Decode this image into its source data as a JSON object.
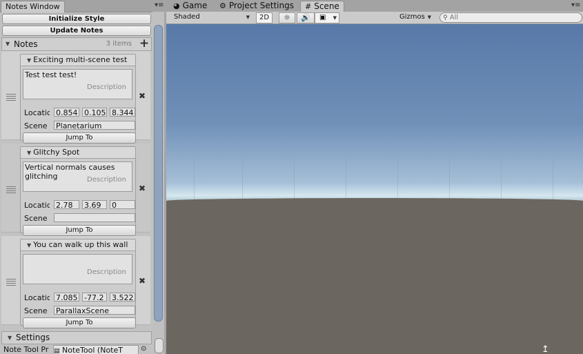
{
  "left_panel": {
    "tab_title": "Notes Window",
    "initialize_style_label": "Initialize Style",
    "update_notes_label": "Update Notes",
    "notes_header": {
      "title": "Notes",
      "count": "3 items"
    },
    "notes": [
      {
        "title": "Exciting multi-scene test",
        "description": "Test test test!",
        "description_placeholder": "Description",
        "location_label": "Locatic",
        "location": [
          "0.854",
          "0.105",
          "8.344"
        ],
        "scene_label": "Scene",
        "scene": "Planetarium",
        "jump_label": "Jump To"
      },
      {
        "title": "Glitchy Spot",
        "description": "Vertical normals causes glitching",
        "description_placeholder": "Description",
        "location_label": "Locatic",
        "location": [
          "2.78",
          "3.69",
          "0"
        ],
        "scene_label": "Scene",
        "scene": "",
        "jump_label": "Jump To"
      },
      {
        "title": "You can walk up this wall",
        "description": "",
        "description_placeholder": "Description",
        "location_label": "Locatic",
        "location": [
          "7.085",
          "-77.2",
          "3.522"
        ],
        "scene_label": "Scene",
        "scene": "ParallaxScene",
        "jump_label": "Jump To"
      }
    ],
    "settings": {
      "title": "Settings",
      "row_label": "Note Tool Pr",
      "row_value": "NoteTool (NoteT"
    }
  },
  "right_panel": {
    "tabs": [
      {
        "label": "Game",
        "icon": "pacman-icon"
      },
      {
        "label": "Project Settings",
        "icon": "gear-icon"
      },
      {
        "label": "Scene",
        "icon": "grid-icon"
      }
    ],
    "toolbar": {
      "shading_mode": "Shaded",
      "toggle_2d": "2D",
      "gizmos_label": "Gizmos",
      "search_placeholder": "All"
    }
  }
}
